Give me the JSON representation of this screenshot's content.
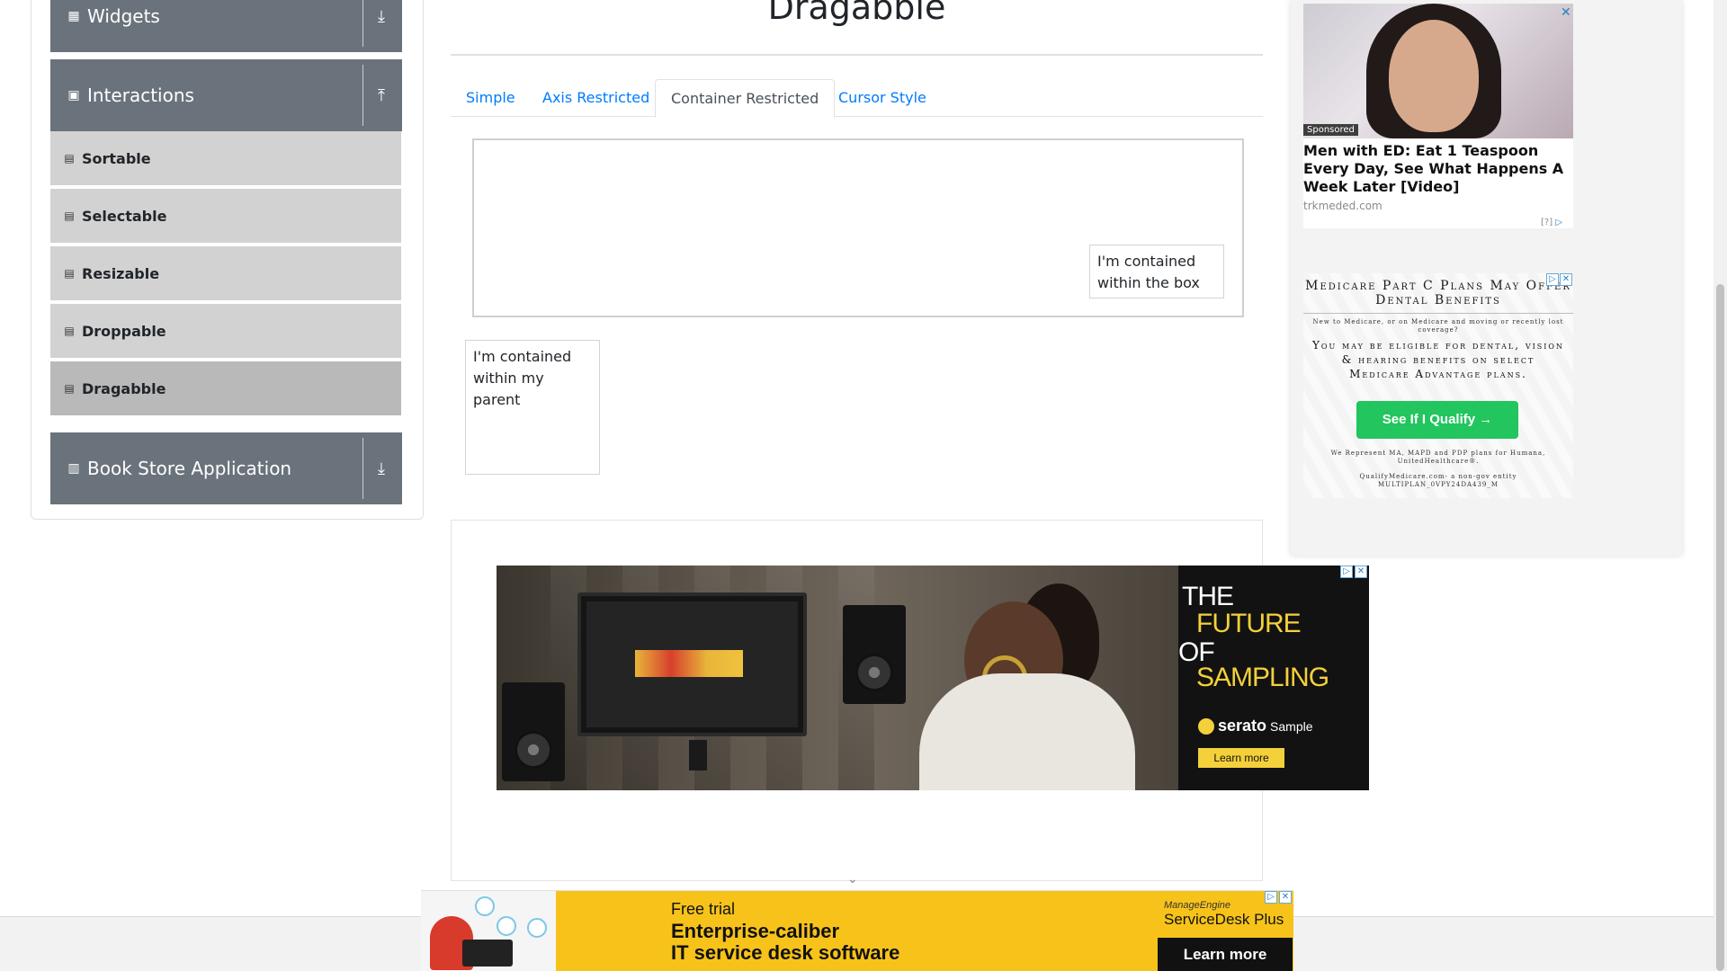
{
  "sidebar": {
    "groups": [
      {
        "title": "Widgets",
        "icon": "widgets-icon",
        "toggle": "download-icon"
      },
      {
        "title": "Interactions",
        "icon": "interactions-icon",
        "toggle": "upload-icon"
      },
      {
        "title": "Book Store Application",
        "icon": "books-icon",
        "toggle": "download-icon"
      }
    ],
    "items": [
      {
        "label": "Sortable"
      },
      {
        "label": "Selectable"
      },
      {
        "label": "Resizable"
      },
      {
        "label": "Droppable"
      },
      {
        "label": "Dragabble"
      }
    ],
    "active_item": "Dragabble"
  },
  "main": {
    "title": "Dragabble",
    "tabs": [
      {
        "label": "Simple"
      },
      {
        "label": "Axis Restricted"
      },
      {
        "label": "Container Restricted"
      },
      {
        "label": "Cursor Style"
      }
    ],
    "active_tab": "Container Restricted",
    "box_text": "I'm contained within the box",
    "parent_text": "I'm contained within my parent"
  },
  "ads": {
    "right_top": {
      "sponsored": "Sponsored",
      "headline": "Men with ED: Eat 1 Teaspoon Every Day, See What Happens A Week Later [Video]",
      "domain": "trkmeded.com",
      "help": "[?]"
    },
    "right_bottom": {
      "heading": "Medicare Part C Plans May Offer Dental Benefits",
      "subheading": "New to Medicare, or on Medicare and moving or recently lost coverage?",
      "body": "You may be eligible for dental, vision & hearing benefits on select Medicare Advantage plans.",
      "cta": "See If I Qualify →",
      "fine_print": "We Represent MA, MAPD and PDP plans for Humana, UnitedHealthcare®.",
      "fine_print_2": "QualifyMedicare.com- a non-gov entity MULTIPLAN_0VPY24DA439_M"
    },
    "middle": {
      "line1": "THE",
      "line2": "FUTURE",
      "line3": "OF",
      "line4": "SAMPLING",
      "brand": "serato",
      "product": "Sample",
      "cta": "Learn more"
    },
    "bottom": {
      "line1": "Free trial",
      "line2": "Enterprise-caliber",
      "line3": "IT service desk software",
      "brand1": "ManageEngine",
      "brand2": "ServiceDesk Plus",
      "cta": "Learn more"
    }
  },
  "colors": {
    "group_header": "#6a737c",
    "menu_item": "#d2d2d2",
    "menu_item_active": "#b9b9b9",
    "link": "#007bff",
    "ad_cta_green": "#22c55e",
    "ad_yellow": "#f7c31a"
  }
}
